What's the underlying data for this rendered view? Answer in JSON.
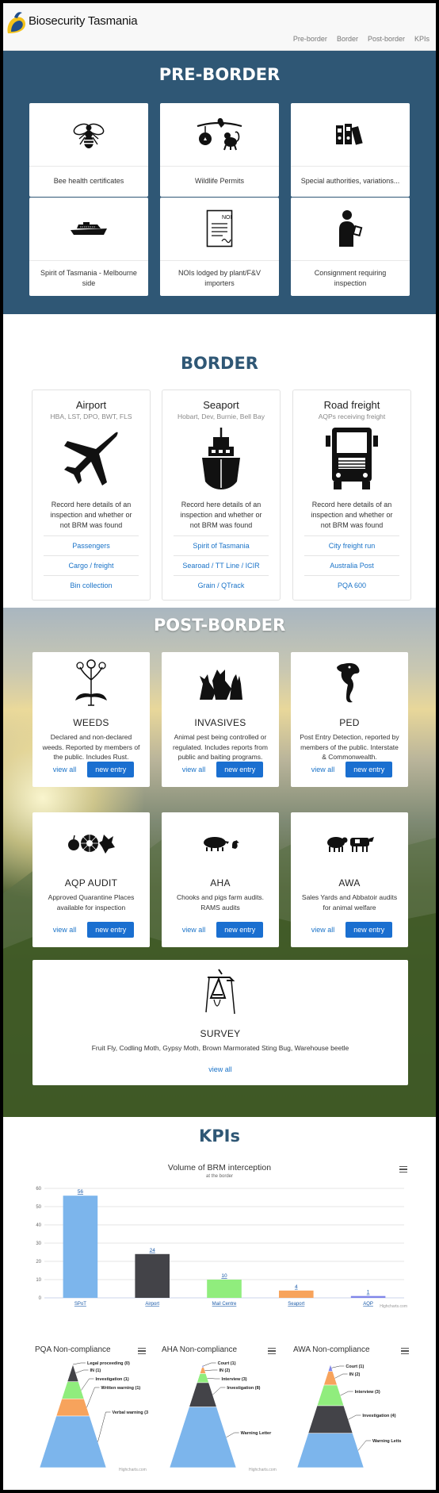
{
  "header": {
    "brand": "Biosecurity Tasmania",
    "nav": [
      "Pre-border",
      "Border",
      "Post-border",
      "KPIs"
    ]
  },
  "pre_border": {
    "title": "PRE-BORDER",
    "cards": [
      {
        "label": "Bee health certificates",
        "icon": "bee-icon"
      },
      {
        "label": "Wildlife Permits",
        "icon": "wildlife-icon"
      },
      {
        "label": "Special authorities, variations...",
        "icon": "binders-icon"
      },
      {
        "label": "Spirit of Tasmania - Melbourne side",
        "icon": "ferry-icon"
      },
      {
        "label": "NOIs lodged by plant/F&V importers",
        "icon": "noi-document-icon"
      },
      {
        "label": "Consignment requiring inspection",
        "icon": "inspector-icon"
      }
    ]
  },
  "border": {
    "title": "BORDER",
    "cards": [
      {
        "title": "Airport",
        "subtitle": "HBA, LST, DPO, BWT, FLS",
        "icon": "airplane-icon",
        "desc": "Record here details of an inspection and whether or not BRM was found",
        "links": [
          "Passengers",
          "Cargo / freight",
          "Bin collection"
        ]
      },
      {
        "title": "Seaport",
        "subtitle": "Hobart, Dev, Burnie, Bell Bay",
        "icon": "ship-icon",
        "desc": "Record here details of an inspection and whether or not BRM was found",
        "links": [
          "Spirit of Tasmania",
          "Searoad / TT Line / ICIR",
          "Grain / QTrack"
        ]
      },
      {
        "title": "Road freight",
        "subtitle": "AQPs receiving freight",
        "icon": "truck-icon",
        "desc": "Record here details of an inspection and whether or not BRM was found",
        "links": [
          "City freight run",
          "Australia Post",
          "PQA 600"
        ]
      }
    ]
  },
  "post_border": {
    "title": "POST-BORDER",
    "view_all": "view all",
    "new_entry": "new entry",
    "cards": [
      {
        "title": "WEEDS",
        "icon": "weed-plant-icon",
        "desc": "Declared and non-declared weeds. Reported by members of the public. Includes Rust."
      },
      {
        "title": "INVASIVES",
        "icon": "fox-cat-rabbit-icon",
        "desc": "Animal pest being controlled or regulated. Includes reports from public and baiting programs."
      },
      {
        "title": "PED",
        "icon": "seahorse-icon",
        "desc": "Post Entry Detection, reported by members of the public. Interstate & Commonwealth."
      },
      {
        "title": "AQP AUDIT",
        "icon": "apple-flower-icon",
        "desc": "Approved Quarantine Places available for inspection"
      },
      {
        "title": "AHA",
        "icon": "pig-chicken-icon",
        "desc": "Chooks and pigs farm audits. RAMS audits"
      },
      {
        "title": "AWA",
        "icon": "sheep-cattle-icon",
        "desc": "Sales Yards and Abbatoir audits for animal welfare"
      }
    ],
    "survey": {
      "title": "SURVEY",
      "icon": "trap-icon",
      "desc": "Fruit Fly, Codling Moth, Gypsy Moth, Brown Marmorated Sting Bug, Warehouse beetle"
    }
  },
  "kpis": {
    "title": "KPIs",
    "credit": "Highcharts.com",
    "colors": {
      "blue": "#7cb5ec",
      "dark": "#434348",
      "green": "#90ed7d",
      "orange": "#f7a35c",
      "purple": "#8085e9"
    }
  },
  "chart_data": [
    {
      "type": "bar",
      "title": "Volume of BRM interception",
      "subtitle": "at the border",
      "categories": [
        "SPoT",
        "Airport",
        "Mail Centre",
        "Seaport",
        "AQP"
      ],
      "values": [
        56,
        24,
        10,
        4,
        1
      ],
      "colors": [
        "#7cb5ec",
        "#434348",
        "#90ed7d",
        "#f7a35c",
        "#8085e9"
      ],
      "ylim": [
        0,
        60
      ],
      "yticks": [
        0,
        10,
        20,
        30,
        40,
        50,
        60
      ],
      "grid": true
    },
    {
      "type": "pyramid",
      "title": "PQA Non-compliance",
      "labels": [
        "Legal proceeding (0)",
        "IN (1)",
        "Investigation (1)",
        "Written warning (1)",
        "Verbal warning (3"
      ],
      "values": [
        0,
        1,
        1,
        1,
        3
      ],
      "colors": [
        "#7cb5ec",
        "#434348",
        "#90ed7d",
        "#f7a35c",
        "#7cb5ec"
      ]
    },
    {
      "type": "pyramid",
      "title": "AHA Non-compliance",
      "labels": [
        "Court (1)",
        "IN (2)",
        "Interview (3)",
        "Investigation (8)",
        "Warning Letter"
      ],
      "values": [
        1,
        2,
        3,
        8,
        20
      ],
      "colors": [
        "#8085e9",
        "#f7a35c",
        "#90ed7d",
        "#434348",
        "#7cb5ec"
      ]
    },
    {
      "type": "pyramid",
      "title": "AWA Non-compliance",
      "labels": [
        "Court (1)",
        "IN (2)",
        "Interview (3)",
        "Investigation (4)",
        "Warning Letts"
      ],
      "values": [
        1,
        2,
        3,
        4,
        5
      ],
      "colors": [
        "#8085e9",
        "#f7a35c",
        "#90ed7d",
        "#434348",
        "#7cb5ec"
      ]
    }
  ]
}
